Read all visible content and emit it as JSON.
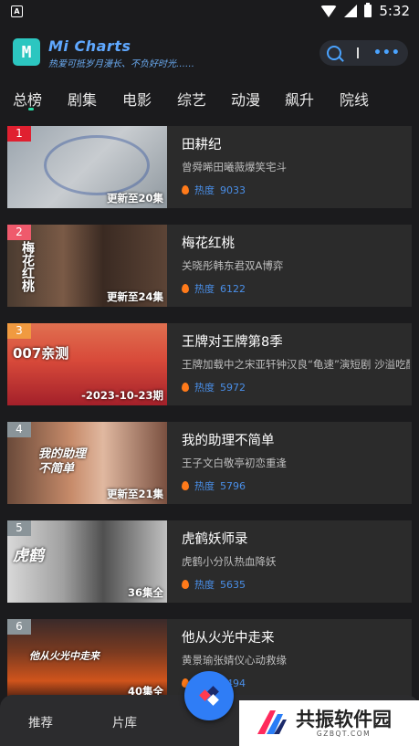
{
  "status_bar": {
    "time": "5:32",
    "left_icon": "A"
  },
  "header": {
    "logo_letter": "M",
    "app_title": "Mi Charts",
    "subtitle": "热爱可抵岁月漫长、不负好时光……",
    "search_icon": "search-icon",
    "more_icon": "more-dots-icon",
    "more_label": "•••"
  },
  "tabs": [
    {
      "label": "总榜",
      "active": true
    },
    {
      "label": "剧集"
    },
    {
      "label": "电影"
    },
    {
      "label": "综艺"
    },
    {
      "label": "动漫"
    },
    {
      "label": "飙升"
    },
    {
      "label": "院线"
    }
  ],
  "items": [
    {
      "rank": "1",
      "title": "田耕纪",
      "desc": "曾舜晞田曦薇爆笑宅斗",
      "heat_label": "热度",
      "heat": "9033",
      "episode": "更新至20集",
      "poster_text": "",
      "rank_color": "#e02030"
    },
    {
      "rank": "2",
      "title": "梅花红桃",
      "desc": "关晓彤韩东君双A博弈",
      "heat_label": "热度",
      "heat": "6122",
      "episode": "更新至24集",
      "poster_text": "梅花红桃",
      "rank_color": "#ef5a6c"
    },
    {
      "rank": "3",
      "title": "王牌对王牌第8季",
      "desc": "王牌加载中之宋亚轩钟汉良“龟速”演短剧 沙溢吃醋",
      "heat_label": "热度",
      "heat": "5972",
      "episode": "-2023-10-23期",
      "poster_text": "007亲测",
      "rank_color": "#f09a40"
    },
    {
      "rank": "4",
      "title": "我的助理不简单",
      "desc": "王子文白敬亭初恋重逢",
      "heat_label": "热度",
      "heat": "5796",
      "episode": "更新至21集",
      "poster_text": "我的助理不简单",
      "rank_color": "#8a9499"
    },
    {
      "rank": "5",
      "title": "虎鹤妖师录",
      "desc": "虎鹤小分队热血降妖",
      "heat_label": "热度",
      "heat": "5635",
      "episode": "36集全",
      "poster_text": "虎鹤",
      "rank_color": "#8a9499"
    },
    {
      "rank": "6",
      "title": "他从火光中走来",
      "desc": "黄景瑜张婧仪心动救缘",
      "heat_label": "热度",
      "heat": "5494",
      "episode": "40集全",
      "poster_text": "他从火光中走来",
      "rank_color": "#8a9499"
    }
  ],
  "bottom_nav": [
    {
      "label": "推荐"
    },
    {
      "label": "片库"
    }
  ],
  "watermark": {
    "main": "共振软件园",
    "sub": "GZBQT.COM"
  },
  "colors": {
    "accent": "#2f7df6",
    "indicator": "#2ad9a4",
    "heat": "#4a8fe8",
    "logo_bg": "#2cc6c0"
  }
}
